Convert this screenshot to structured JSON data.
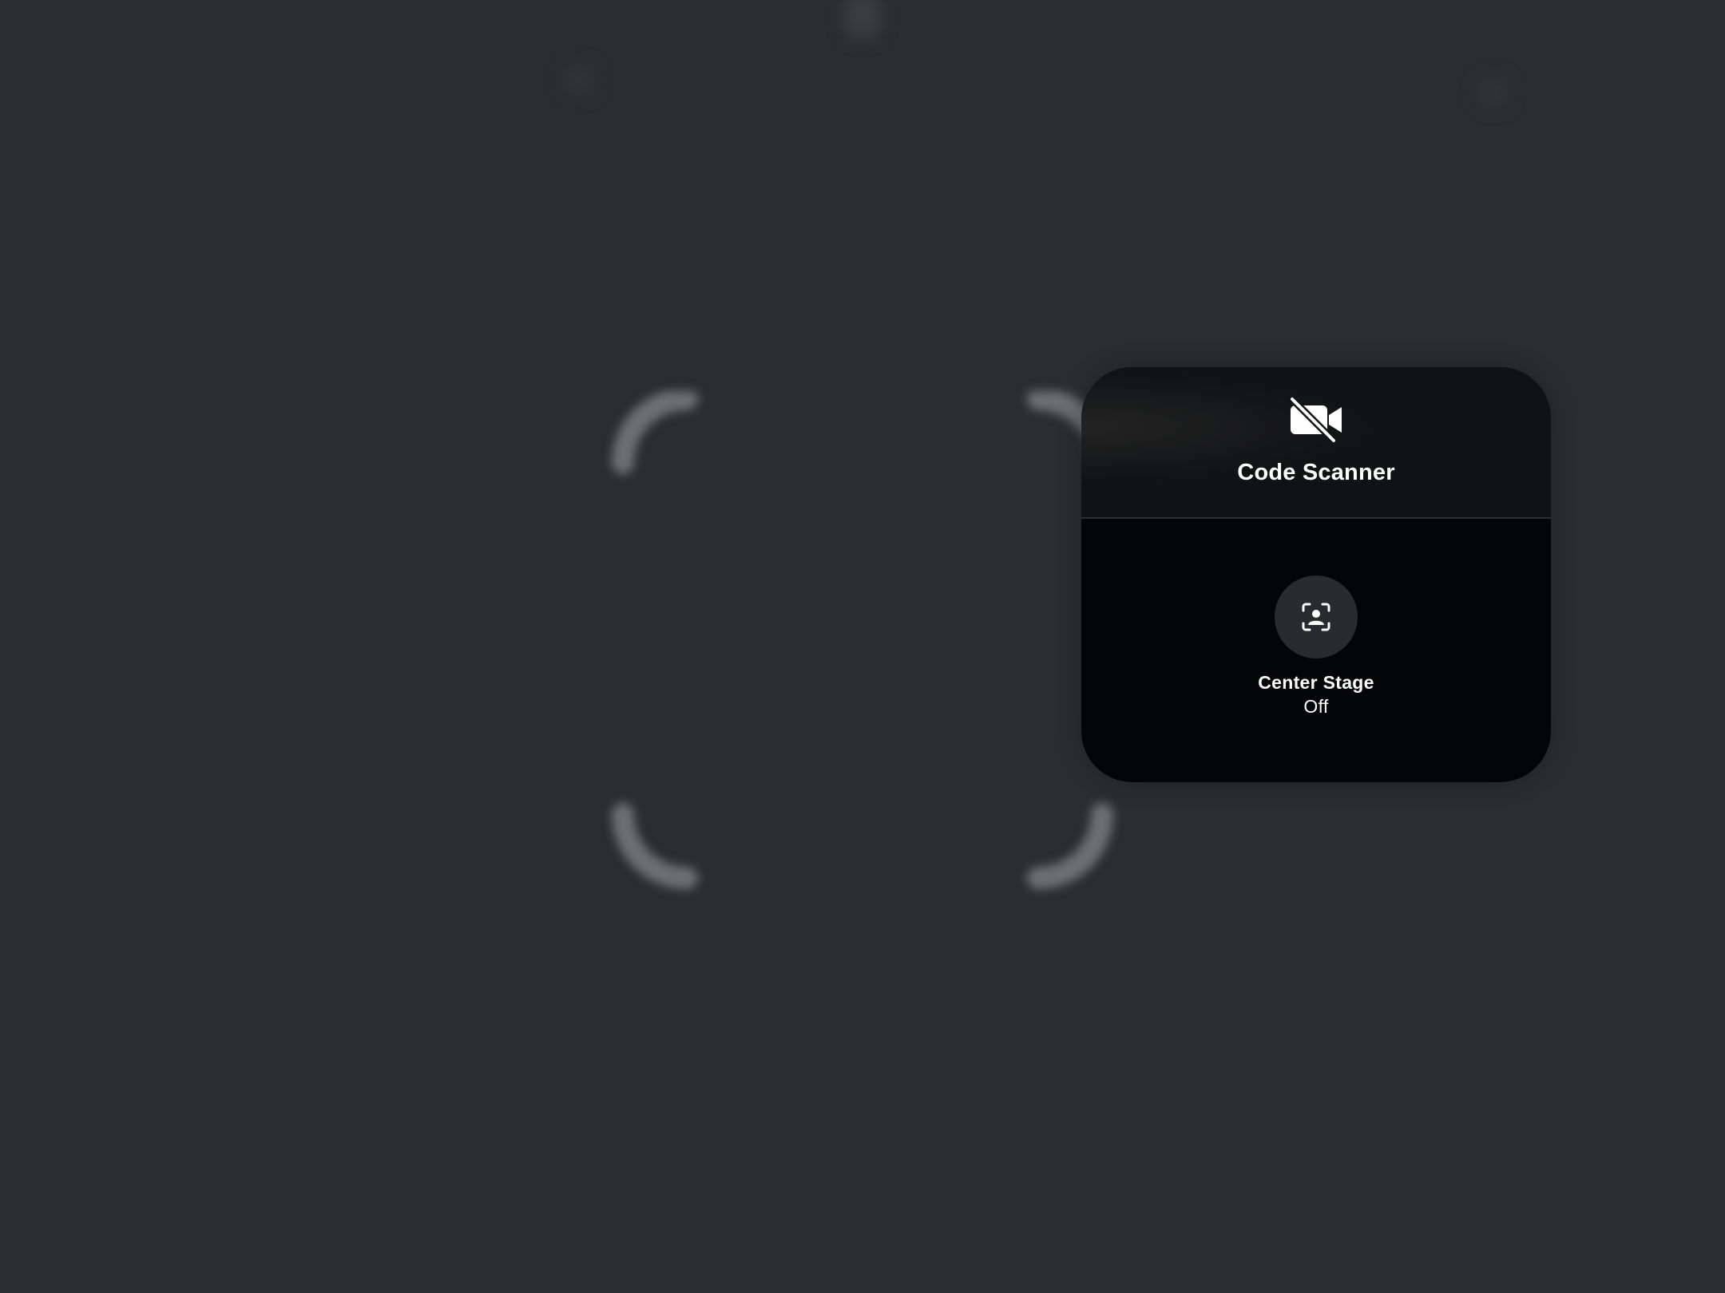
{
  "app": {
    "title": "Code Scanner",
    "camera_icon": "video-slash-icon"
  },
  "controls": {
    "center_stage": {
      "label": "Center Stage",
      "state": "Off",
      "icon": "person-viewfinder-icon"
    }
  },
  "colors": {
    "background": "#2c2d2f",
    "panel": "#040506",
    "panel_header": "#111214",
    "button": "#2a2b2e",
    "text": "#ffffff",
    "scan_frame": "#6e6f71"
  }
}
